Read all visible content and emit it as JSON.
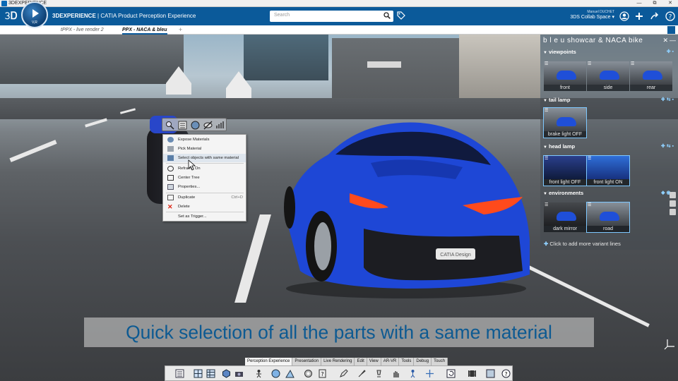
{
  "os": {
    "title": "3DEXPERIENCE",
    "controls": [
      "—",
      "⧉",
      "✕"
    ]
  },
  "header": {
    "compass_version": "V,R",
    "brand_bold": "3DEXPERIENCE",
    "brand_rest": " | CATIA Product Perception Experience",
    "search_placeholder": "Search",
    "user_name": "Manuel DUCHET",
    "space": "3DS Collab Space ▾"
  },
  "tabs": [
    {
      "label": "tPPX - live render 2",
      "active": false
    },
    {
      "label": "PPX - NACA & bleu",
      "active": true
    }
  ],
  "tab_add": "+",
  "panel": {
    "title": "b l e u  showcar & NACA bike",
    "close": "✕",
    "dash": "—",
    "sections": [
      {
        "name": "viewpoints",
        "thumbs": [
          "front",
          "side",
          "rear"
        ]
      },
      {
        "name": "tail lamp",
        "thumbs": [
          "brake light OFF"
        ]
      },
      {
        "name": "head lamp",
        "thumbs": [
          "front light OFF",
          "front light ON"
        ]
      },
      {
        "name": "environments",
        "thumbs": [
          "dark mirror",
          "road"
        ]
      }
    ],
    "add_variant": "Click to add more variant lines"
  },
  "context_menu": {
    "items": [
      {
        "label": "Expose Materials",
        "shortcut": ""
      },
      {
        "label": "Pick Material",
        "shortcut": ""
      },
      {
        "label": "Select objects with same material",
        "shortcut": ""
      },
      {
        "label": "Reframe On",
        "shortcut": ""
      },
      {
        "label": "Center Tree",
        "shortcut": ""
      },
      {
        "label": "Properties...",
        "shortcut": ""
      },
      {
        "label": "Duplicate",
        "shortcut": "Ctrl+D"
      },
      {
        "label": "Delete",
        "shortcut": ""
      },
      {
        "label": "Set as Trigger...",
        "shortcut": ""
      }
    ]
  },
  "caption": "Quick selection of all the parts with a same material",
  "car_plate": "CATIA Design",
  "action_tabs": [
    "Perception Experience",
    "Presentation",
    "Live Rendering",
    "Edit",
    "View",
    "AR-VR",
    "Tools",
    "Debug",
    "Touch"
  ],
  "colors": {
    "brand_blue": "#0b5a9a",
    "car_blue": "#1d45d6",
    "caption_text": "#0d5a92",
    "panel_accent": "#8fd0ff"
  }
}
